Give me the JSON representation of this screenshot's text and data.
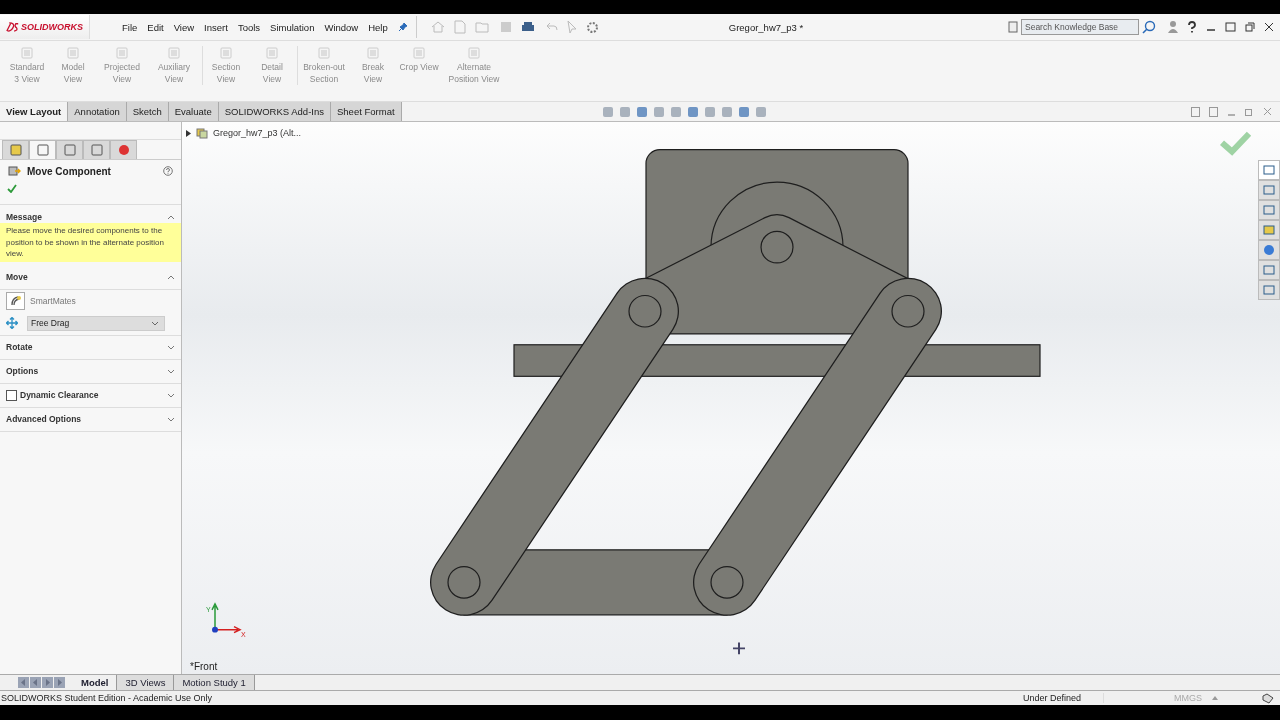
{
  "app": {
    "logo": "SOLIDWORKS",
    "document_title": "Gregor_hw7_p3 *"
  },
  "menu": [
    "File",
    "Edit",
    "View",
    "Insert",
    "Tools",
    "Simulation",
    "Window",
    "Help"
  ],
  "search": {
    "placeholder": "Search Knowledge Base"
  },
  "ribbon": [
    {
      "label": "Standard 3 View",
      "disabled": true
    },
    {
      "label": "Model View",
      "disabled": true
    },
    {
      "label": "Projected View",
      "disabled": true
    },
    {
      "label": "Auxiliary View",
      "disabled": true
    },
    {
      "label": "Section View",
      "disabled": true
    },
    {
      "label": "Detail View",
      "disabled": true
    },
    {
      "label": "Broken-out Section",
      "disabled": true
    },
    {
      "label": "Break View",
      "disabled": true
    },
    {
      "label": "Crop View",
      "disabled": true
    },
    {
      "label": "Alternate Position View",
      "disabled": true
    }
  ],
  "tabs": [
    {
      "label": "View Layout",
      "selected": true
    },
    {
      "label": "Annotation",
      "selected": false
    },
    {
      "label": "Sketch",
      "selected": false
    },
    {
      "label": "Evaluate",
      "selected": false
    },
    {
      "label": "SOLIDWORKS Add-Ins",
      "selected": false
    },
    {
      "label": "Sheet Format",
      "selected": false
    }
  ],
  "property_manager": {
    "title": "Move Component",
    "message_heading": "Message",
    "message": "Please move the desired components to the position to be shown in the alternate position view.",
    "move": {
      "heading": "Move",
      "expanded": true,
      "smartmates": "SmartMates",
      "mode": "Free Drag"
    },
    "sections": [
      {
        "kind": "plain",
        "label": "Rotate",
        "expanded": false
      },
      {
        "kind": "plain",
        "label": "Options",
        "expanded": false
      },
      {
        "kind": "checkbox",
        "label": "Dynamic Clearance",
        "checked": false,
        "expanded": false
      },
      {
        "kind": "plain",
        "label": "Advanced Options",
        "expanded": false
      }
    ]
  },
  "tree": {
    "label": "Gregor_hw7_p3  (Alt..."
  },
  "panel_tabs": [
    {
      "selected": false
    },
    {
      "selected": true
    },
    {
      "selected": false
    },
    {
      "selected": false
    },
    {
      "selected": false
    }
  ],
  "task_pane_tabs": [
    {
      "selected": true
    },
    {
      "selected": false
    },
    {
      "selected": false
    },
    {
      "selected": false
    },
    {
      "selected": false
    },
    {
      "selected": false
    },
    {
      "selected": false
    }
  ],
  "viewport": {
    "axis_y": "Y",
    "axis_x": "X",
    "view_name": "*Front"
  },
  "bottom_tabs": [
    {
      "label": "Model",
      "selected": true
    },
    {
      "label": "3D Views",
      "selected": false
    },
    {
      "label": "Motion Study 1",
      "selected": false
    }
  ],
  "status_bar": {
    "edition": "SOLIDWORKS Student Edition - Academic Use Only",
    "state": "Under Defined",
    "units": "MMGS"
  }
}
